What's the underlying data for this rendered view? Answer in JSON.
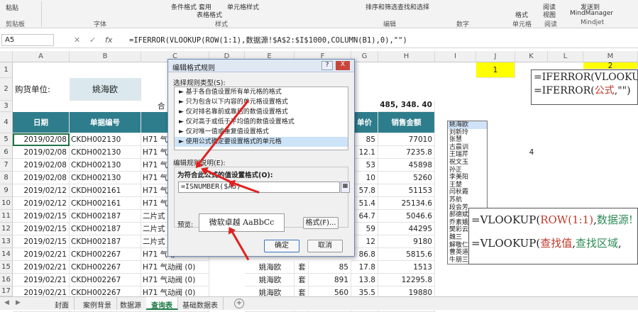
{
  "ribbon": {
    "row1": [
      "粘贴",
      "条件格式",
      "套用",
      "单元格样式",
      "排序和筛选",
      "查找和选择",
      "阅读",
      "发送到"
    ],
    "row2": [
      "表格格式",
      "格式",
      "视图",
      "MindManager"
    ],
    "groups": [
      "剪贴板",
      "字体",
      "样式",
      "编辑",
      "数字",
      "单元格",
      "阅读",
      "Mindjet"
    ]
  },
  "formula_bar": {
    "name_box": "A5",
    "fx": "fx",
    "formula": "=IFERROR(VLOOKUP(ROW(1:1),数据源!$A$2:$I$1000,COLUMN(B1),0),\"\")"
  },
  "columns": [
    "A",
    "B",
    "C",
    "D",
    "E",
    "F",
    "G",
    "H",
    "I",
    "J",
    "K",
    "L",
    "M"
  ],
  "rows": [
    "1",
    "2",
    "3",
    "4",
    "5",
    "6",
    "7",
    "8",
    "9",
    "10",
    "11",
    "12",
    "13",
    "14",
    "15",
    "16",
    "17",
    "18"
  ],
  "sheet": {
    "buyer_label": "购货单位:",
    "buyer_value": "姚海欧",
    "total_prefix": "合",
    "total_value": "485, 348. 40",
    "headers": {
      "date": "日期",
      "doc_no": "单据编号",
      "price": "单价",
      "sales": "销售金额"
    },
    "table": [
      {
        "date": "2019/02/08",
        "doc": "CKDH002130",
        "name": "H71 气动",
        "price": "85",
        "sales": "77010"
      },
      {
        "date": "2019/02/08",
        "doc": "CKDH002130",
        "name": "H71 气动",
        "price": "12.1",
        "sales": "7235.8"
      },
      {
        "date": "2019/02/08",
        "doc": "CKDH002130",
        "name": "H71 气动",
        "price": "53",
        "sales": "45898"
      },
      {
        "date": "2019/02/08",
        "doc": "CKDH002130",
        "name": "H71 气动",
        "price": "10",
        "sales": "5260"
      },
      {
        "date": "2019/02/12",
        "doc": "CKDH002161",
        "name": "H71 气动",
        "price": "57.8",
        "sales": "51153"
      },
      {
        "date": "2019/02/12",
        "doc": "CKDH002161",
        "name": "H71 气动",
        "price": "51.4",
        "sales": "25134.6"
      },
      {
        "date": "2019/02/15",
        "doc": "CKDH002187",
        "name": "二片式",
        "price": "64.7",
        "sales": "5046.6"
      },
      {
        "date": "2019/02/15",
        "doc": "CKDH002187",
        "name": "二片式",
        "price": "59",
        "sales": "44295"
      },
      {
        "date": "2019/02/15",
        "doc": "CKDH002187",
        "name": "二片式",
        "price": "12",
        "sales": "9180"
      },
      {
        "date": "2019/02/21",
        "doc": "CKDH002267",
        "name": "H71 气动",
        "price": "86.8",
        "sales": "5815.6"
      },
      {
        "date": "2019/02/21",
        "doc": "CKDH002267",
        "name": "H71 气动阀 (0)",
        "customer": "姚海欧",
        "unit": "套",
        "qty": "85",
        "price": "17.8",
        "sales": "1513"
      },
      {
        "date": "2019/02/21",
        "doc": "CKDH002267",
        "name": "H71 气动阀 (0)",
        "customer": "姚海欧",
        "unit": "套",
        "qty": "891",
        "price": "13.8",
        "sales": "12295.8"
      },
      {
        "date": "2019/02/21",
        "doc": "CKDH002267",
        "name": "H71 气动阀 (0)",
        "customer": "姚海欧",
        "unit": "套",
        "qty": "560",
        "price": "35.5",
        "sales": "19880"
      },
      {
        "date": "2019/02/21",
        "doc": "CKDH002267",
        "name": "H71 气动阀 (0)",
        "customer": "姚海欧",
        "unit": "套",
        "qty": "936",
        "price": "78.3",
        "sales": "73288.8"
      }
    ],
    "j1_value": "1",
    "m1_value": "2",
    "k_value": "4"
  },
  "note_top": {
    "line1": "=IFERROR(VLOOKUP(RO",
    "line2_prefix": "=IFERROR(",
    "line2_mid": "公式",
    "line2_suffix": ",\"\")"
  },
  "note_bottom": {
    "line1_a": "=VLOOKUP(",
    "line1_b": "ROW(1:1)",
    "line1_c": ",",
    "line1_d": "数据源!",
    "line2_a": "=VLOOKUP(",
    "line2_b": "查找值",
    "line2_c": ",",
    "line2_d": "查找区域",
    "line2_e": ","
  },
  "name_list": [
    "姚海欧",
    "刘新玲",
    "张慧",
    "古晨训",
    "王瑞芹",
    "祝文玉",
    "孙正",
    "李美阳",
    "王楚",
    "闫秋霞",
    "苏航",
    "段会芳",
    "郝德斌",
    "乔素娥",
    "樊彩云",
    "魏三",
    "解敬仁",
    "曹英道",
    "牛朋三"
  ],
  "dialog": {
    "title": "编辑格式规则",
    "help": "?",
    "close": "X",
    "section1": "选择规则类型(S):",
    "rules": [
      "► 基于各自值设置所有单元格的格式",
      "► 只为包含以下内容的单元格设置格式",
      "► 仅对排名靠前或靠后的数值设置格式",
      "► 仅对高于或低于平均值的数值设置格式",
      "► 仅对唯一值或重复值设置格式",
      "► 使用公式确定要设置格式的单元格"
    ],
    "section2": "编辑规则说明(E):",
    "formula_label": "为符合此公式的值设置格式(O):",
    "formula_value": "=ISNUMBER($A5)",
    "preview_label": "预览:",
    "preview_text": "微软卓越  AaBbCc",
    "format_button": "格式(F)...",
    "ok_button": "确定",
    "cancel_button": "取消"
  },
  "tabs": [
    "封面",
    "案例背景",
    "数据源",
    "查询表",
    "基础数据表"
  ],
  "active_tab": "查询表",
  "accent_colors": {
    "header": "#2e7d8c",
    "highlight": "#ffff00",
    "arrow": "#e0201e",
    "active_tab": "#1e7b45"
  }
}
